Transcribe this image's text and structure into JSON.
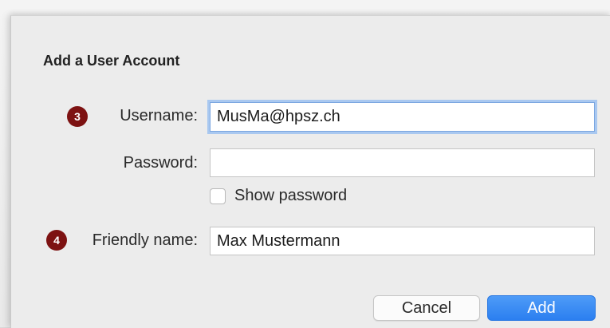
{
  "dialog": {
    "title": "Add a User Account"
  },
  "form": {
    "username": {
      "badge": "3",
      "label": "Username:",
      "value": "MusMa@hpsz.ch"
    },
    "password": {
      "label": "Password:",
      "value": ""
    },
    "show_password": {
      "label": "Show password",
      "checked": false
    },
    "friendly_name": {
      "badge": "4",
      "label": "Friendly name:",
      "value": "Max Mustermann"
    }
  },
  "buttons": {
    "cancel_label": "Cancel",
    "add_label": "Add"
  },
  "colors": {
    "badge": "#7d1212",
    "accent": "#2b7ff0",
    "focus_ring": "#a9c8f0"
  }
}
